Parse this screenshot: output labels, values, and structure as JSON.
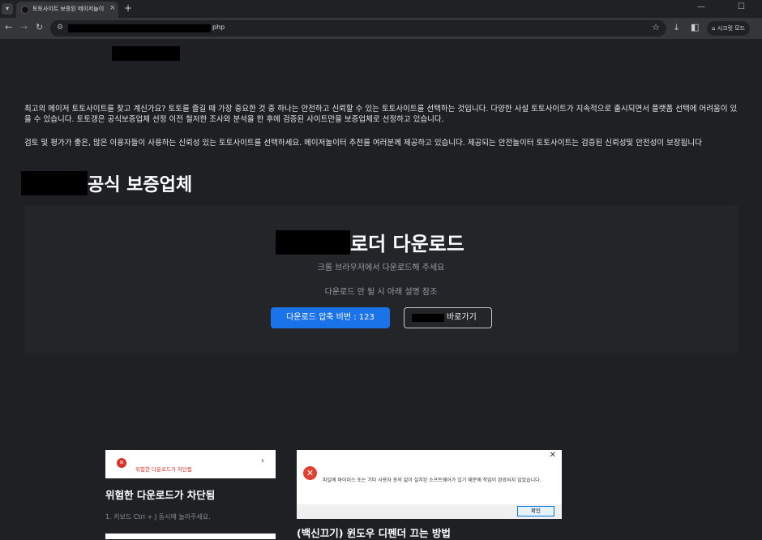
{
  "browser": {
    "tab_title": "토토사이트 보증된 메이저놀이",
    "tab_close": "×",
    "new_tab": "+",
    "url_suffix": "php",
    "incognito_label": "시크릿 모드",
    "icons": [
      "back-icon",
      "forward-icon",
      "reload-icon",
      "site-info-icon",
      "star-icon",
      "download-icon",
      "sidepanel-icon",
      "incognito-icon",
      "minimize-icon",
      "maximize-icon"
    ]
  },
  "intro": {
    "p1": "최고의 메이저 토토사이트를 찾고 계신가요? 토토를 즐길 때 가장 중요한 것 중 하나는 안전하고 신뢰할 수 있는 토토사이트를 선택하는 것입니다. 다양한 사설 토토사이트가 지속적으로 출시되면서 플랫폼 선택에 어려움이 있을 수 있습니다. 토토갱은 공식보증업체 선정 이전 철저한 조사와 분석을 한 후에 검증된 사이트만을 보증업체로 선정하고 있습니다.",
    "p2": "검토 및 평가가 좋은, 많은 이용자들이 사용하는 신뢰성 있는 토토사이트를 선택하세요. 메이저놀이터 추천를 여러분께 제공하고 있습니다. 제공되는 안전놀이터 토토사이트는 검증된 신뢰성및 안전성이 보장됩니다"
  },
  "section": {
    "title": "공식 보증업체"
  },
  "download_panel": {
    "heading": "로더 다운로드",
    "sub1": "크롬 브라우저에서 다운로드해 주세요",
    "sub2": "다운로드 안 될 시 아래 설명 참조",
    "btn_password": "다운로드 압축 비번 : 123",
    "btn_shortcut": "바로가기",
    "accent": "#1a73e8"
  },
  "cards": [
    {
      "thumb_text": "위험한 다운로드가 차단됨",
      "title": "위험한 다운로드가 차단됨",
      "desc": "1. 키보드 Ctrl + J 동시에 눌러주세요."
    },
    {
      "dialog_msg": "파일에 바이러스 또는 기타 사용자 동의 없이 설치된 소프트웨어가 있기 때문에 작업이 완료되지 않았습니다.",
      "dialog_ok": "확인",
      "title": "(백신끄기) 윈도우 디펜더 끄는 방법"
    }
  ]
}
